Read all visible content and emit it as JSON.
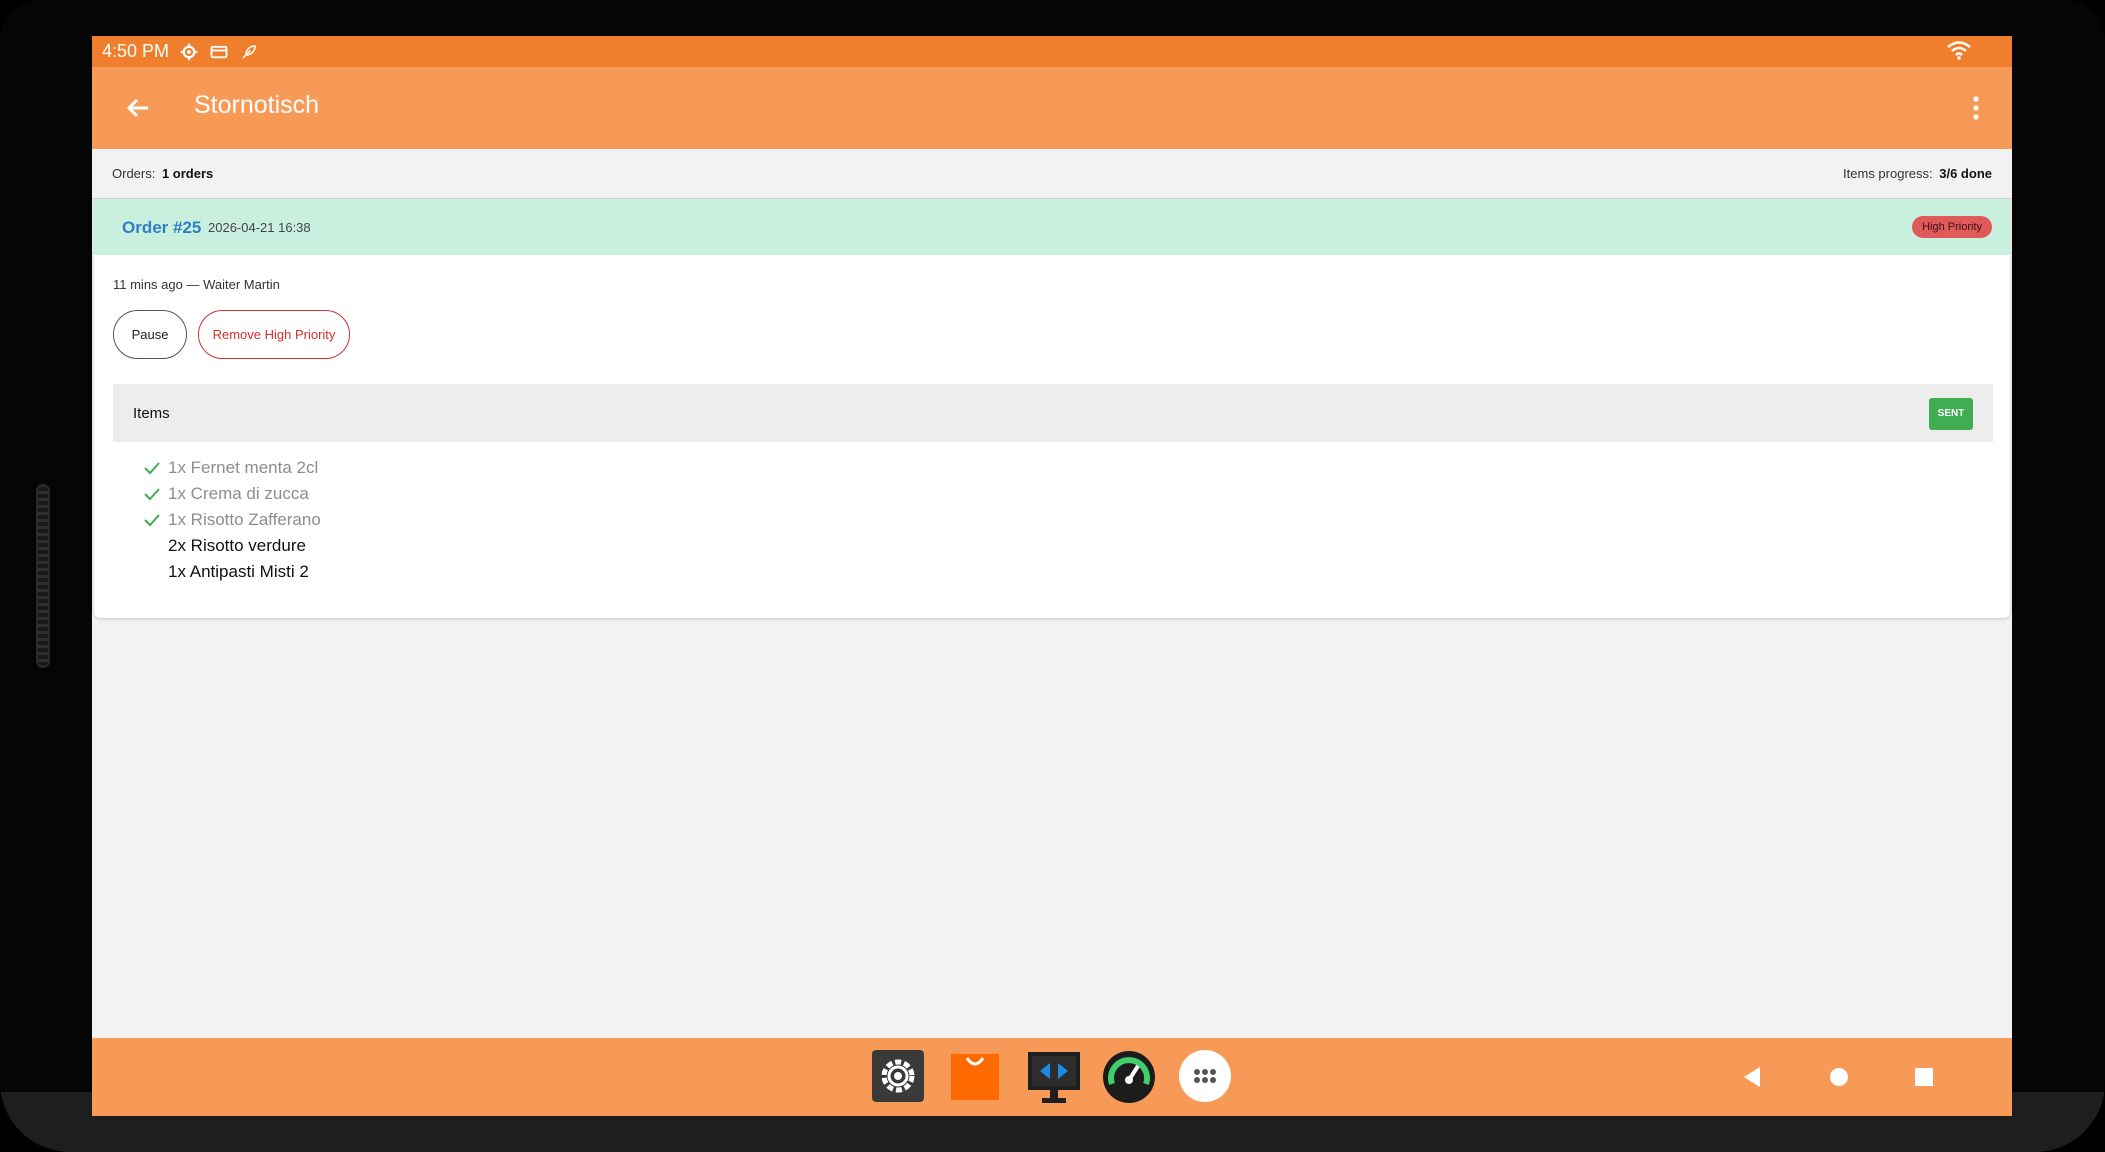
{
  "status_bar": {
    "time": "4:50 PM",
    "icons": [
      "settings-gear-icon",
      "card-icon",
      "feather-icon",
      "wifi-icon"
    ]
  },
  "app_bar": {
    "title": "Stornotisch",
    "back_icon": "arrow-back-icon",
    "menu_icon": "more-vert-icon"
  },
  "summary": {
    "orders_label": "Orders:",
    "orders_value": "1 orders",
    "progress_label": "Items progress:",
    "progress_value": "3/6 done"
  },
  "order": {
    "number": "Order #25",
    "date": "2026-04-21 16:38",
    "priority_badge": "High Priority",
    "meta": "11 mins ago — Waiter Martin",
    "pause_label": "Pause",
    "remove_priority_label": "Remove High Priority",
    "items_title": "Items",
    "items_status": "SENT",
    "items": [
      {
        "text": "1x Fernet menta 2cl",
        "done": true
      },
      {
        "text": "1x Crema di zucca",
        "done": true
      },
      {
        "text": "1x Risotto Zafferano",
        "done": true
      },
      {
        "text": "2x Risotto verdure",
        "done": false
      },
      {
        "text": "1x Antipasti Misti 2",
        "done": false
      }
    ]
  },
  "nav_bar": {
    "dock_apps": [
      "settings-app-icon",
      "store-app-icon",
      "remote-desktop-app-icon",
      "speedometer-app-icon",
      "app-drawer-icon"
    ],
    "buttons": [
      "nav-back-icon",
      "nav-home-icon",
      "nav-recents-icon"
    ]
  },
  "colors": {
    "status_bar": "#f07f2d",
    "app_bar": "#f89a57",
    "order_header": "#c9f0df",
    "order_link": "#2f80c4",
    "priority": "#e05a5a",
    "sent": "#3fae52",
    "check": "#3fae52"
  }
}
